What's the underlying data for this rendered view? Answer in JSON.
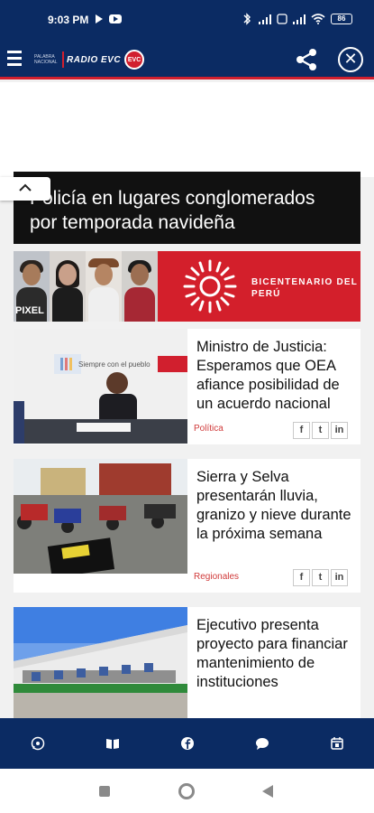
{
  "status_bar": {
    "time": "9:03 PM",
    "battery": "86"
  },
  "header": {
    "logo_small": "PALABRA NACIONAL",
    "logo_text": "RADIO EVC",
    "logo_badge": "EVC"
  },
  "hero": {
    "title": "Policía en lugares conglomerados por temporada navideña"
  },
  "banner": {
    "pixel_text": "PIXEL",
    "brand_text": "BICENTENARIO DEL PERÚ"
  },
  "cards": [
    {
      "title": "Ministro de Justicia: Esperamos que OEA afiance posibilidad de un acuerdo nacional",
      "category": "Política",
      "image_text": "Siempre con el pueblo"
    },
    {
      "title": "Sierra y Selva presentarán lluvia, granizo y nieve durante la próxima semana",
      "category": "Regionales"
    },
    {
      "title": "Ejecutivo presenta proyecto para financiar mantenimiento de instituciones",
      "category": ""
    }
  ],
  "social": {
    "facebook": "f",
    "twitter": "t",
    "linkedin": "in"
  },
  "bottom_nav": [
    "whatsapp-icon",
    "book-icon",
    "facebook-icon",
    "chat-icon",
    "calendar-icon"
  ]
}
